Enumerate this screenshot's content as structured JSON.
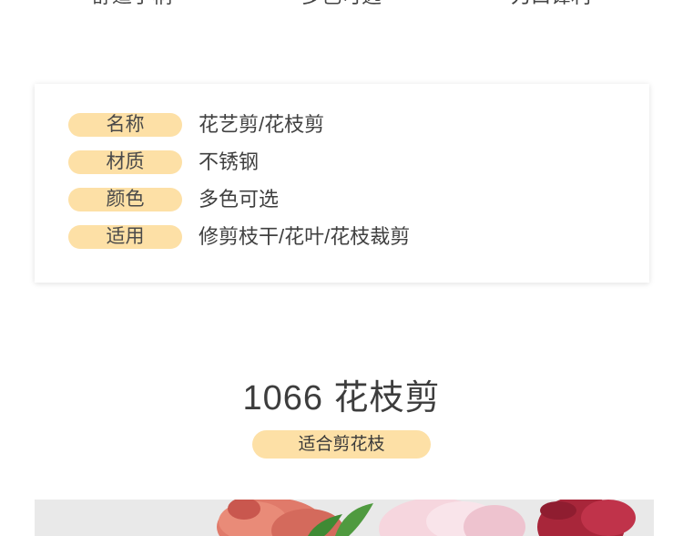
{
  "features": [
    "舒适手柄",
    "多色可选",
    "刀口锋利"
  ],
  "specs": [
    {
      "label": "名称",
      "value": "花艺剪/花枝剪"
    },
    {
      "label": "材质",
      "value": "不锈钢"
    },
    {
      "label": "颜色",
      "value": "多色可选"
    },
    {
      "label": "适用",
      "value": "修剪枝干/花叶/花枝裁剪"
    }
  ],
  "product": {
    "title": "1066 花枝剪",
    "tagline": "适合剪花枝"
  },
  "colors": {
    "pill": "#fde0a6",
    "text": "#3f3f3f",
    "card_bg": "#ffffff",
    "photo_bg": "#e9e9e9"
  }
}
